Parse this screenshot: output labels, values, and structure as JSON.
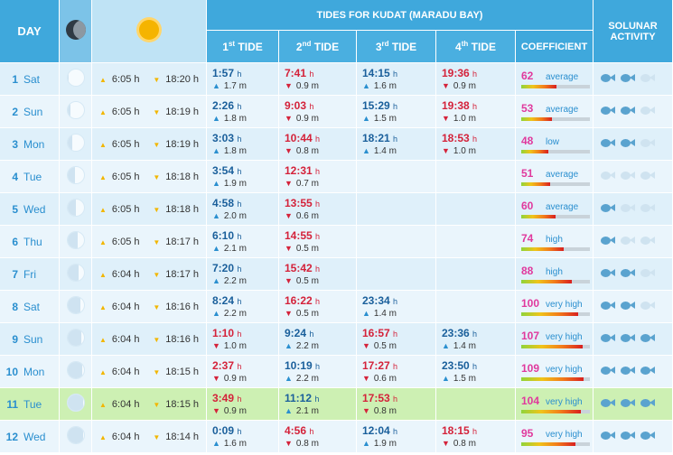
{
  "header": {
    "day": "DAY",
    "title": "TIDES FOR KUDAT (MARADU BAY)",
    "solunar": "SOLUNAR ACTIVITY",
    "tide1_num": "1",
    "tide1_suf": "st",
    "tide1_word": "TIDE",
    "tide2_num": "2",
    "tide2_suf": "nd",
    "tide2_word": "TIDE",
    "tide3_num": "3",
    "tide3_suf": "rd",
    "tide3_word": "TIDE",
    "tide4_num": "4",
    "tide4_suf": "th",
    "tide4_word": "TIDE",
    "coefficient": "COEFFICIENT"
  },
  "icons": {
    "moon": "moon-icon",
    "sun": "sun-icon",
    "fish": "fish-icon"
  },
  "colors": {
    "header": "#3fa8dc",
    "today": "#cdf0b3",
    "high_time": "#1a5f9b",
    "low_time": "#d4223a",
    "coef_value": "#e0399d"
  },
  "rows": [
    {
      "num": "1",
      "day": "Sat",
      "moon": 0.08,
      "sunrise": "6:05 h",
      "sunset": "18:20 h",
      "tides": [
        {
          "t": "1:57",
          "u": "h",
          "hgt": "1.7 m",
          "type": "high"
        },
        {
          "t": "7:41",
          "u": "h",
          "hgt": "0.9 m",
          "type": "low"
        },
        {
          "t": "14:15",
          "u": "h",
          "hgt": "1.6 m",
          "type": "high"
        },
        {
          "t": "19:36",
          "u": "h",
          "hgt": "0.9 m",
          "type": "low"
        }
      ],
      "coef": "62",
      "coef_label": "average",
      "fish": 2
    },
    {
      "num": "2",
      "day": "Sun",
      "moon": 0.2,
      "sunrise": "6:05 h",
      "sunset": "18:19 h",
      "tides": [
        {
          "t": "2:26",
          "u": "h",
          "hgt": "1.8 m",
          "type": "high"
        },
        {
          "t": "9:03",
          "u": "h",
          "hgt": "0.9 m",
          "type": "low"
        },
        {
          "t": "15:29",
          "u": "h",
          "hgt": "1.5 m",
          "type": "high"
        },
        {
          "t": "19:38",
          "u": "h",
          "hgt": "1.0 m",
          "type": "low"
        }
      ],
      "coef": "53",
      "coef_label": "average",
      "fish": 2
    },
    {
      "num": "3",
      "day": "Mon",
      "moon": 0.32,
      "sunrise": "6:05 h",
      "sunset": "18:19 h",
      "tides": [
        {
          "t": "3:03",
          "u": "h",
          "hgt": "1.8 m",
          "type": "high"
        },
        {
          "t": "10:44",
          "u": "h",
          "hgt": "0.8 m",
          "type": "low"
        },
        {
          "t": "18:21",
          "u": "h",
          "hgt": "1.4 m",
          "type": "high"
        },
        {
          "t": "18:53",
          "u": "h",
          "hgt": "1.0 m",
          "type": "low"
        }
      ],
      "coef": "48",
      "coef_label": "low",
      "fish": 2
    },
    {
      "num": "4",
      "day": "Tue",
      "moon": 0.45,
      "sunrise": "6:05 h",
      "sunset": "18:18 h",
      "tides": [
        {
          "t": "3:54",
          "u": "h",
          "hgt": "1.9 m",
          "type": "high"
        },
        {
          "t": "12:31",
          "u": "h",
          "hgt": "0.7 m",
          "type": "low"
        }
      ],
      "coef": "51",
      "coef_label": "average",
      "fish": 0
    },
    {
      "num": "5",
      "day": "Wed",
      "moon": 0.55,
      "sunrise": "6:05 h",
      "sunset": "18:18 h",
      "tides": [
        {
          "t": "4:58",
          "u": "h",
          "hgt": "2.0 m",
          "type": "high"
        },
        {
          "t": "13:55",
          "u": "h",
          "hgt": "0.6 m",
          "type": "low"
        }
      ],
      "coef": "60",
      "coef_label": "average",
      "fish": 1
    },
    {
      "num": "6",
      "day": "Thu",
      "moon": 0.62,
      "sunrise": "6:05 h",
      "sunset": "18:17 h",
      "tides": [
        {
          "t": "6:10",
          "u": "h",
          "hgt": "2.1 m",
          "type": "high"
        },
        {
          "t": "14:55",
          "u": "h",
          "hgt": "0.5 m",
          "type": "low"
        }
      ],
      "coef": "74",
      "coef_label": "high",
      "fish": 1
    },
    {
      "num": "7",
      "day": "Fri",
      "moon": 0.7,
      "sunrise": "6:04 h",
      "sunset": "18:17 h",
      "tides": [
        {
          "t": "7:20",
          "u": "h",
          "hgt": "2.2 m",
          "type": "high"
        },
        {
          "t": "15:42",
          "u": "h",
          "hgt": "0.5 m",
          "type": "low"
        }
      ],
      "coef": "88",
      "coef_label": "high",
      "fish": 2
    },
    {
      "num": "8",
      "day": "Sat",
      "moon": 0.78,
      "sunrise": "6:04 h",
      "sunset": "18:16 h",
      "tides": [
        {
          "t": "8:24",
          "u": "h",
          "hgt": "2.2 m",
          "type": "high"
        },
        {
          "t": "16:22",
          "u": "h",
          "hgt": "0.5 m",
          "type": "low"
        },
        {
          "t": "23:34",
          "u": "h",
          "hgt": "1.4 m",
          "type": "high"
        }
      ],
      "coef": "100",
      "coef_label": "very high",
      "fish": 2
    },
    {
      "num": "9",
      "day": "Sun",
      "moon": 0.86,
      "sunrise": "6:04 h",
      "sunset": "18:16 h",
      "tides": [
        {
          "t": "1:10",
          "u": "h",
          "hgt": "1.0 m",
          "type": "low"
        },
        {
          "t": "9:24",
          "u": "h",
          "hgt": "2.2 m",
          "type": "high"
        },
        {
          "t": "16:57",
          "u": "h",
          "hgt": "0.5 m",
          "type": "low"
        },
        {
          "t": "23:36",
          "u": "h",
          "hgt": "1.4 m",
          "type": "high"
        }
      ],
      "coef": "107",
      "coef_label": "very high",
      "fish": 3
    },
    {
      "num": "10",
      "day": "Mon",
      "moon": 0.93,
      "sunrise": "6:04 h",
      "sunset": "18:15 h",
      "tides": [
        {
          "t": "2:37",
          "u": "h",
          "hgt": "0.9 m",
          "type": "low"
        },
        {
          "t": "10:19",
          "u": "h",
          "hgt": "2.2 m",
          "type": "high"
        },
        {
          "t": "17:27",
          "u": "h",
          "hgt": "0.6 m",
          "type": "low"
        },
        {
          "t": "23:50",
          "u": "h",
          "hgt": "1.5 m",
          "type": "high"
        }
      ],
      "coef": "109",
      "coef_label": "very high",
      "fish": 3
    },
    {
      "num": "11",
      "day": "Tue",
      "moon": 0.97,
      "sunrise": "6:04 h",
      "sunset": "18:15 h",
      "tides": [
        {
          "t": "3:49",
          "u": "h",
          "hgt": "0.9 m",
          "type": "low"
        },
        {
          "t": "11:12",
          "u": "h",
          "hgt": "2.1 m",
          "type": "high"
        },
        {
          "t": "17:53",
          "u": "h",
          "hgt": "0.8 m",
          "type": "low"
        }
      ],
      "coef": "104",
      "coef_label": "very high",
      "fish": 3,
      "today": true
    },
    {
      "num": "12",
      "day": "Wed",
      "moon": 0.99,
      "sunrise": "6:04 h",
      "sunset": "18:14 h",
      "tides": [
        {
          "t": "0:09",
          "u": "h",
          "hgt": "1.6 m",
          "type": "high"
        },
        {
          "t": "4:56",
          "u": "h",
          "hgt": "0.8 m",
          "type": "low"
        },
        {
          "t": "12:04",
          "u": "h",
          "hgt": "1.9 m",
          "type": "high"
        },
        {
          "t": "18:15",
          "u": "h",
          "hgt": "0.8 m",
          "type": "low"
        }
      ],
      "coef": "95",
      "coef_label": "very high",
      "fish": 3
    }
  ]
}
